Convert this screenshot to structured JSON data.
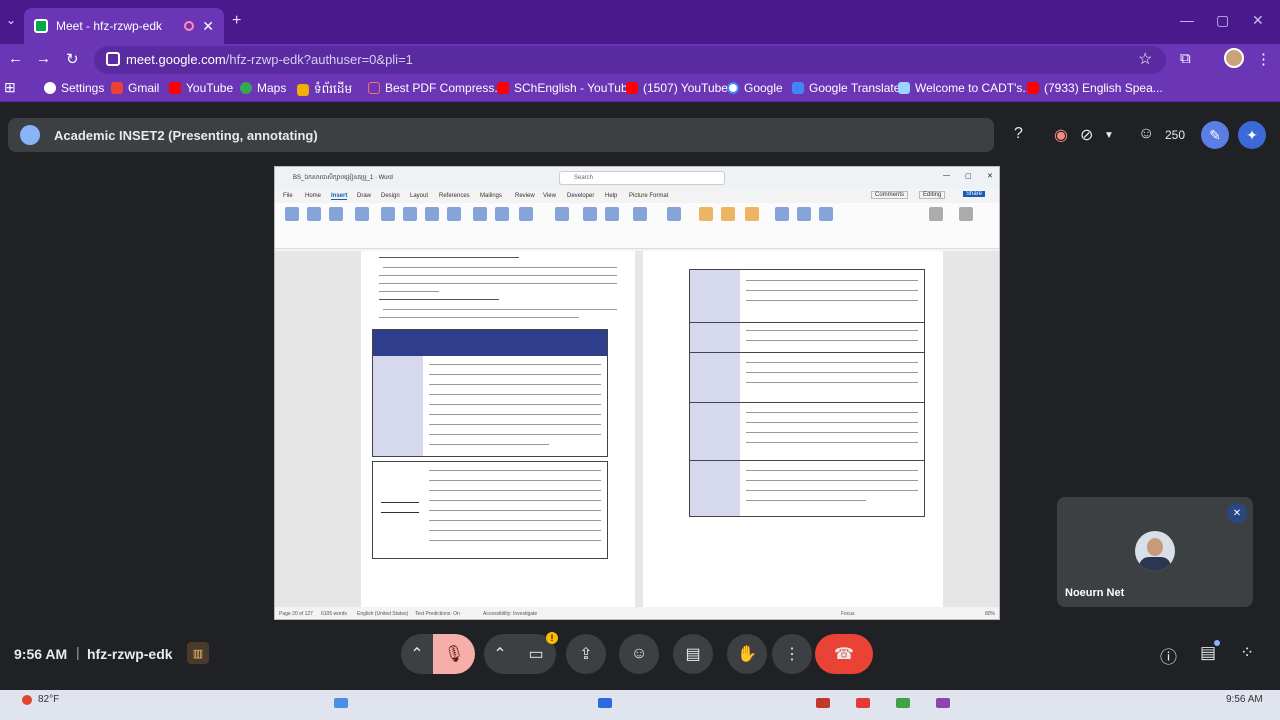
{
  "browser": {
    "tab_title": "Meet - hfz-rzwp-edk",
    "url_host": "meet.google.com",
    "url_path": "/hfz-rzwp-edk?authuser=0&pli=1",
    "bookmarks": [
      "Settings",
      "Gmail",
      "YouTube",
      "Maps",
      "ទំព័រដើម",
      "Best PDF Compress...",
      "SChEnglish - YouTube",
      "(1507) YouTube",
      "Google",
      "Google Translate",
      "Welcome to CADT's...",
      "(7933) English Spea..."
    ]
  },
  "meet": {
    "title": "Academic INSET2 (Presenting, annotating)",
    "participant_count": "250",
    "participant_name": "Noeurn Net",
    "time": "9:56 AM",
    "meeting_code": "hfz-rzwp-edk"
  },
  "word": {
    "title": "BS_ឯកសារបាសិក្សាបង្រៀនគម្រូ_1 · Word",
    "search": "Search",
    "menu": [
      "File",
      "Home",
      "Insert",
      "Draw",
      "Design",
      "Layout",
      "References",
      "Mailings",
      "Review",
      "View",
      "Developer",
      "Help",
      "Picture Format"
    ],
    "comments_btn": "Comments",
    "editing_btn": "Editing",
    "share_btn": "Share",
    "status": {
      "page": "Page 20 of 127",
      "words": "6105 words",
      "language": "English (United States)",
      "predictions": "Text Predictions: On",
      "accessibility": "Accessibility: Investigate",
      "focus": "Focus",
      "zoom": "80%"
    }
  },
  "taskbar": {
    "weather": "82°F",
    "time": "9:56 AM"
  },
  "colors": {
    "tab_strip": "#4a1a8c",
    "toolbar": "#6b36b5",
    "meet_bg": "#202124",
    "end_call": "#ea4335",
    "mic_muted": "#f6aea9"
  }
}
